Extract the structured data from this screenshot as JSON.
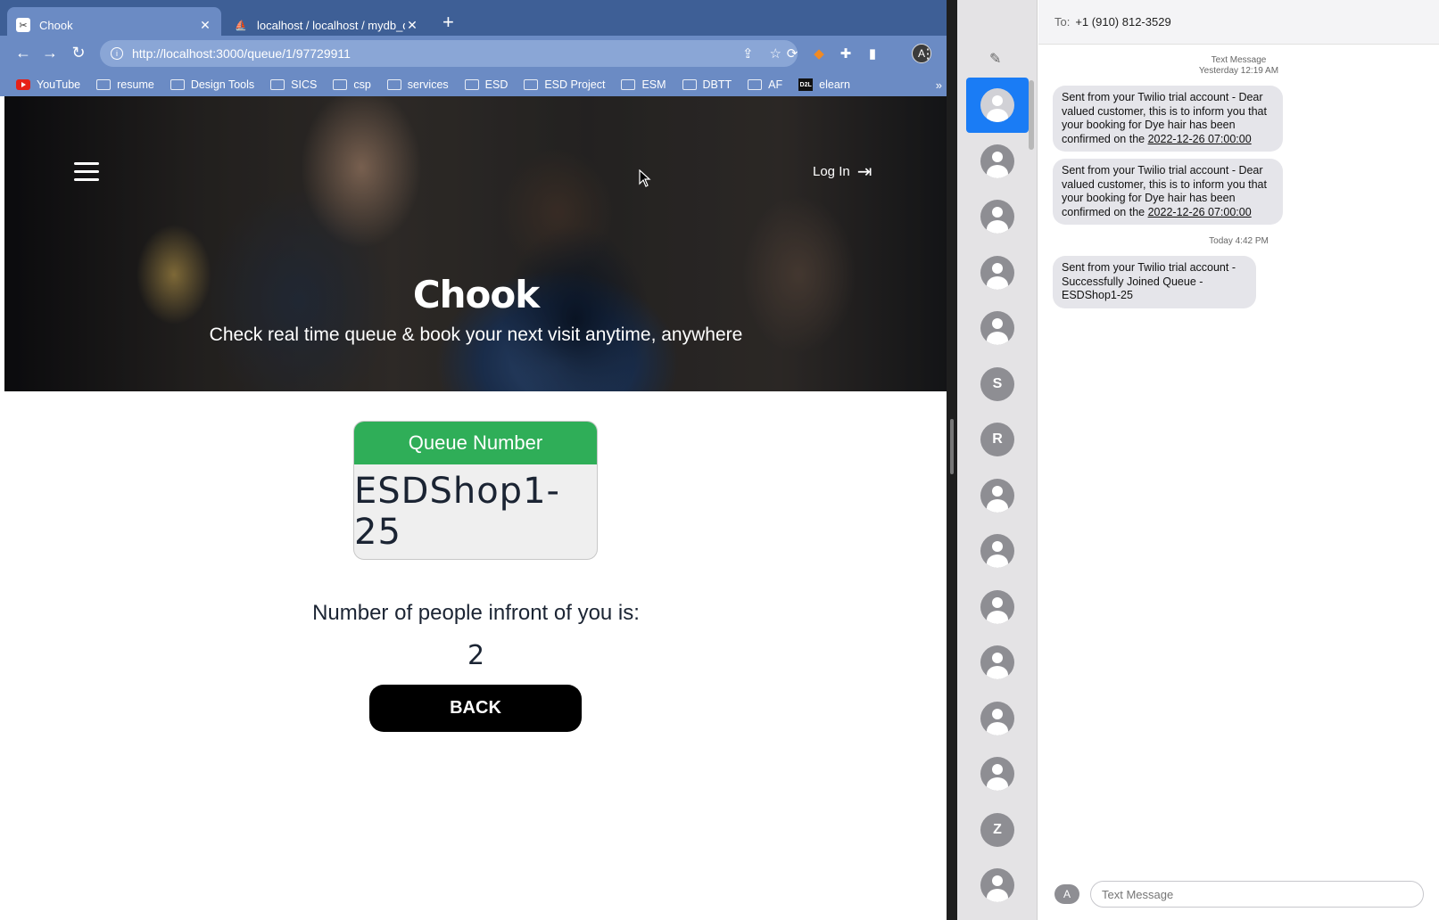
{
  "browser": {
    "tabs": [
      {
        "title": "Chook",
        "active": true
      },
      {
        "title": "localhost / localhost / mydb_qu",
        "active": false
      }
    ],
    "url": "http://localhost:3000/queue/1/97729911",
    "profile_initial": "A",
    "bookmarks": [
      "YouTube",
      "resume",
      "Design Tools",
      "SICS",
      "csp",
      "services",
      "ESD",
      "ESD Project",
      "ESM",
      "DBTT",
      "AF",
      "elearn"
    ],
    "bookmarks_more": "»"
  },
  "page": {
    "login_label": "Log In",
    "title": "Chook",
    "subtitle": "Check real time queue & book your next visit anytime, anywhere",
    "queue_card_header": "Queue Number",
    "queue_number": "ESDShop1-25",
    "people_label": "Number of people infront of you is:",
    "people_count": "2",
    "back_label": "BACK"
  },
  "messages": {
    "to_label": "To:",
    "recipient": "+1 (910) 812-3529",
    "conversations": [
      {
        "kind": "person",
        "selected": true
      },
      {
        "kind": "person"
      },
      {
        "kind": "person"
      },
      {
        "kind": "person"
      },
      {
        "kind": "person"
      },
      {
        "kind": "initial",
        "initial": "S"
      },
      {
        "kind": "initial",
        "initial": "R"
      },
      {
        "kind": "person"
      },
      {
        "kind": "person"
      },
      {
        "kind": "person"
      },
      {
        "kind": "person"
      },
      {
        "kind": "person"
      },
      {
        "kind": "person"
      },
      {
        "kind": "initial",
        "initial": "Z"
      },
      {
        "kind": "person"
      }
    ],
    "header_timestamp_line1": "Text Message",
    "header_timestamp_line2": "Yesterday 12:19 AM",
    "bubble1": {
      "text": "Sent from your Twilio trial account - Dear valued customer, this is to inform you that your booking for Dye hair has been confirmed on the ",
      "date": "2022-12-26 07:00:00"
    },
    "bubble2": {
      "text": "Sent from your Twilio trial account - Dear valued customer, this is to inform you that your booking for Dye hair has been confirmed on the ",
      "date": "2022-12-26 07:00:00"
    },
    "today_timestamp": "Today 4:42 PM",
    "bubble3": {
      "text": "Sent from your Twilio trial account - Successfully Joined Queue - ESDShop1-25"
    },
    "input_placeholder": "Text Message"
  }
}
